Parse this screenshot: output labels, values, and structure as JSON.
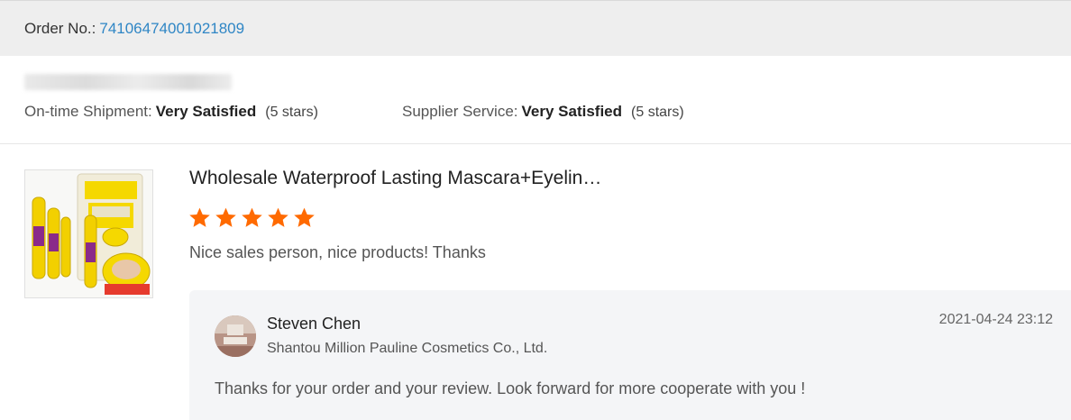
{
  "order": {
    "label": "Order No.:",
    "number": "74106474001021809"
  },
  "summary": {
    "shipment_label": "On-time Shipment:",
    "shipment_value": "Very Satisfied",
    "shipment_stars": "(5 stars)",
    "service_label": "Supplier Service:",
    "service_value": "Very Satisfied",
    "service_stars": "(5 stars)"
  },
  "review": {
    "product_title": "Wholesale Waterproof Lasting Mascara+Eyelin…",
    "rating": 5,
    "rating_max": 5,
    "star_color": "#ff6a00",
    "text": "Nice sales person, nice products! Thanks"
  },
  "reply": {
    "name": "Steven Chen",
    "company": "Shantou Million Pauline Cosmetics Co., Ltd.",
    "date": "2021-04-24 23:12",
    "text": "Thanks for your order and your review. Look forward for more cooperate with you !"
  },
  "colors": {
    "link": "#2f86c5",
    "header_bg": "#eeeeee",
    "reply_bg": "#f4f5f7"
  }
}
